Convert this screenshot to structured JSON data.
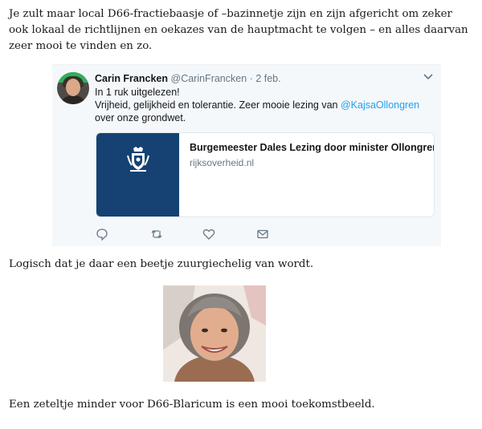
{
  "paragraphs": {
    "intro": "Je zult maar local D66-fractiebaasje of –bazinnetje zijn en zijn afgericht om zeker ook lokaal de richtlijnen en oekazes van de hauptmacht te volgen – en alles daarvan zeer mooi te vinden en zo.",
    "middle": "Logisch dat je daar een beetje zuurgiechelig van wordt.",
    "closing": "Een zeteltje minder voor D66-Blaricum is een mooi toekomstbeeld."
  },
  "tweet": {
    "author_name": "Carin Francken",
    "handle": "@CarinFrancken",
    "separator": "·",
    "date": "2 feb.",
    "line1": "In 1 ruk uitgelezen!",
    "line2_prefix": "Vrijheid, gelijkheid en tolerantie. Zeer mooie lezing van ",
    "mention": "@KajsaOllongren",
    "line2_suffix": " over onze grondwet.",
    "card": {
      "title": "Burgemeester Dales Lezing door minister Ollongren",
      "domain": "rijksoverheid.nl"
    },
    "icons": [
      "reply-icon",
      "retweet-icon",
      "like-icon",
      "dm-icon"
    ]
  },
  "colors": {
    "mention": "#1da1f2",
    "card_image": "#154273",
    "tweet_bg": "#f5f8fa"
  }
}
